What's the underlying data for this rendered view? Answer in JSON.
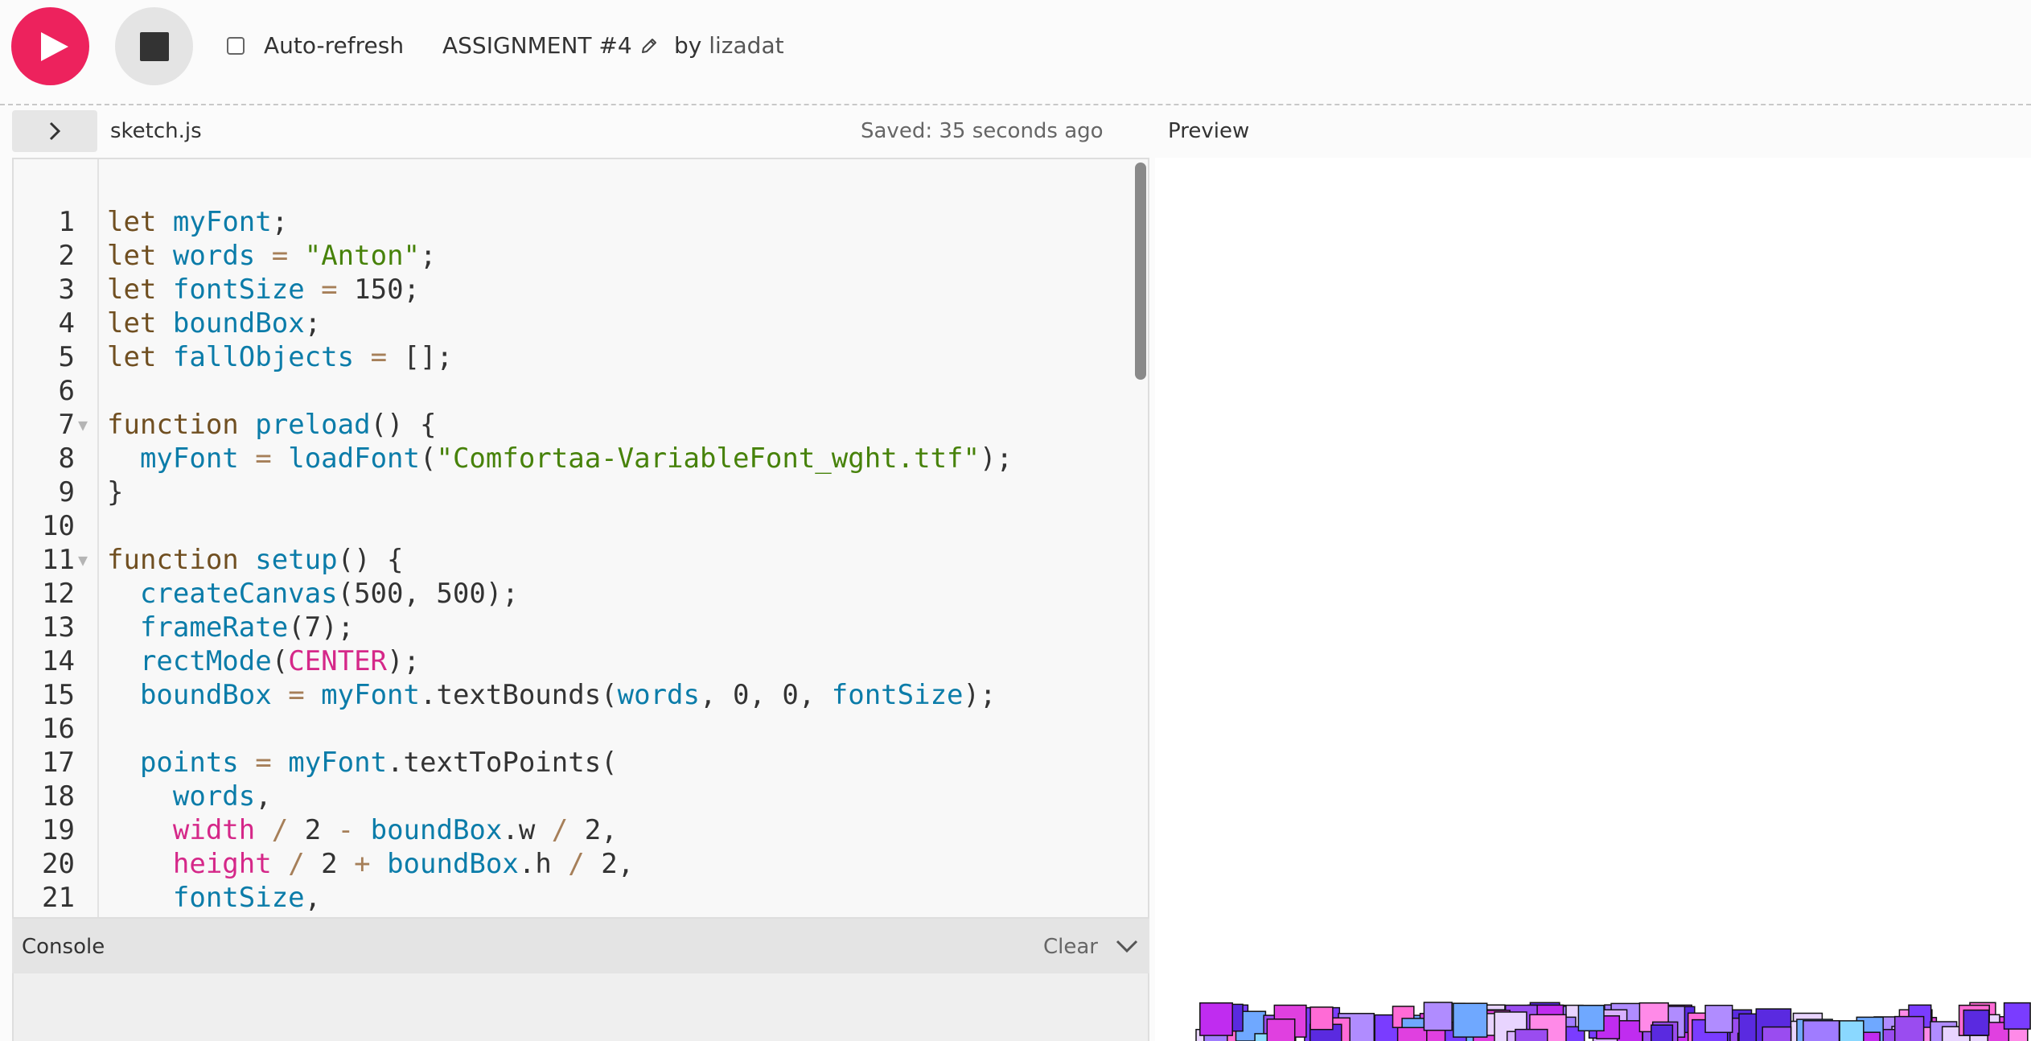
{
  "toolbar": {
    "play_icon": "play-icon",
    "stop_icon": "stop-icon",
    "autorefresh_label": "Auto-refresh",
    "autorefresh_checked": false,
    "project_name": "ASSIGNMENT #4",
    "owner_prefix": "by",
    "owner_name": "lizadat"
  },
  "editor": {
    "file_name": "sketch.js",
    "saved_status": "Saved: 35 seconds ago",
    "lines": [
      {
        "n": "1",
        "fold": false,
        "tokens": [
          [
            "kw",
            "let"
          ],
          [
            "t",
            " "
          ],
          [
            "vr",
            "myFont"
          ],
          [
            "t",
            ";"
          ]
        ]
      },
      {
        "n": "2",
        "fold": false,
        "tokens": [
          [
            "kw",
            "let"
          ],
          [
            "t",
            " "
          ],
          [
            "vr",
            "words"
          ],
          [
            "t",
            " "
          ],
          [
            "op",
            "="
          ],
          [
            "t",
            " "
          ],
          [
            "st",
            "\"Anton\""
          ],
          [
            "t",
            ";"
          ]
        ]
      },
      {
        "n": "3",
        "fold": false,
        "tokens": [
          [
            "kw",
            "let"
          ],
          [
            "t",
            " "
          ],
          [
            "vr",
            "fontSize"
          ],
          [
            "t",
            " "
          ],
          [
            "op",
            "="
          ],
          [
            "t",
            " "
          ],
          [
            "nm",
            "150"
          ],
          [
            "t",
            ";"
          ]
        ]
      },
      {
        "n": "4",
        "fold": false,
        "tokens": [
          [
            "kw",
            "let"
          ],
          [
            "t",
            " "
          ],
          [
            "vr",
            "boundBox"
          ],
          [
            "t",
            ";"
          ]
        ]
      },
      {
        "n": "5",
        "fold": false,
        "tokens": [
          [
            "kw",
            "let"
          ],
          [
            "t",
            " "
          ],
          [
            "vr",
            "fallObjects"
          ],
          [
            "t",
            " "
          ],
          [
            "op",
            "="
          ],
          [
            "t",
            " [];"
          ]
        ]
      },
      {
        "n": "6",
        "fold": false,
        "tokens": []
      },
      {
        "n": "7",
        "fold": true,
        "tokens": [
          [
            "kw",
            "function"
          ],
          [
            "t",
            " "
          ],
          [
            "fn",
            "preload"
          ],
          [
            "t",
            "() {"
          ]
        ]
      },
      {
        "n": "8",
        "fold": false,
        "tokens": [
          [
            "t",
            "  "
          ],
          [
            "vr",
            "myFont"
          ],
          [
            "t",
            " "
          ],
          [
            "op",
            "="
          ],
          [
            "t",
            " "
          ],
          [
            "fn",
            "loadFont"
          ],
          [
            "t",
            "("
          ],
          [
            "st",
            "\"Comfortaa-VariableFont_wght.ttf\""
          ],
          [
            "t",
            ");"
          ]
        ]
      },
      {
        "n": "9",
        "fold": false,
        "tokens": [
          [
            "t",
            "}"
          ]
        ]
      },
      {
        "n": "10",
        "fold": false,
        "tokens": []
      },
      {
        "n": "11",
        "fold": true,
        "tokens": [
          [
            "kw",
            "function"
          ],
          [
            "t",
            " "
          ],
          [
            "fn",
            "setup"
          ],
          [
            "t",
            "() {"
          ]
        ]
      },
      {
        "n": "12",
        "fold": false,
        "tokens": [
          [
            "t",
            "  "
          ],
          [
            "fn",
            "createCanvas"
          ],
          [
            "t",
            "(500, 500);"
          ]
        ]
      },
      {
        "n": "13",
        "fold": false,
        "tokens": [
          [
            "t",
            "  "
          ],
          [
            "fn",
            "frameRate"
          ],
          [
            "t",
            "(7);"
          ]
        ]
      },
      {
        "n": "14",
        "fold": false,
        "tokens": [
          [
            "t",
            "  "
          ],
          [
            "fn",
            "rectMode"
          ],
          [
            "t",
            "("
          ],
          [
            "cn",
            "CENTER"
          ],
          [
            "t",
            ");"
          ]
        ]
      },
      {
        "n": "15",
        "fold": false,
        "tokens": [
          [
            "t",
            "  "
          ],
          [
            "vr",
            "boundBox"
          ],
          [
            "t",
            " "
          ],
          [
            "op",
            "="
          ],
          [
            "t",
            " "
          ],
          [
            "vr",
            "myFont"
          ],
          [
            "t",
            ".textBounds("
          ],
          [
            "vr",
            "words"
          ],
          [
            "t",
            ", 0, 0, "
          ],
          [
            "vr",
            "fontSize"
          ],
          [
            "t",
            ");"
          ]
        ]
      },
      {
        "n": "16",
        "fold": false,
        "tokens": []
      },
      {
        "n": "17",
        "fold": false,
        "tokens": [
          [
            "t",
            "  "
          ],
          [
            "vr",
            "points"
          ],
          [
            "t",
            " "
          ],
          [
            "op",
            "="
          ],
          [
            "t",
            " "
          ],
          [
            "vr",
            "myFont"
          ],
          [
            "t",
            ".textToPoints("
          ]
        ]
      },
      {
        "n": "18",
        "fold": false,
        "tokens": [
          [
            "t",
            "    "
          ],
          [
            "vr",
            "words"
          ],
          [
            "t",
            ","
          ]
        ]
      },
      {
        "n": "19",
        "fold": false,
        "tokens": [
          [
            "t",
            "    "
          ],
          [
            "cn",
            "width"
          ],
          [
            "t",
            " "
          ],
          [
            "op",
            "/"
          ],
          [
            "t",
            " 2 "
          ],
          [
            "op",
            "-"
          ],
          [
            "t",
            " "
          ],
          [
            "vr",
            "boundBox"
          ],
          [
            "t",
            ".w "
          ],
          [
            "op",
            "/"
          ],
          [
            "t",
            " 2,"
          ]
        ]
      },
      {
        "n": "20",
        "fold": false,
        "tokens": [
          [
            "t",
            "    "
          ],
          [
            "cn",
            "height"
          ],
          [
            "t",
            " "
          ],
          [
            "op",
            "/"
          ],
          [
            "t",
            " 2 "
          ],
          [
            "op",
            "+"
          ],
          [
            "t",
            " "
          ],
          [
            "vr",
            "boundBox"
          ],
          [
            "t",
            ".h "
          ],
          [
            "op",
            "/"
          ],
          [
            "t",
            " 2,"
          ]
        ]
      },
      {
        "n": "21",
        "fold": false,
        "tokens": [
          [
            "t",
            "    "
          ],
          [
            "vr",
            "fontSize"
          ],
          [
            "t",
            ","
          ]
        ]
      }
    ]
  },
  "console": {
    "label": "Console",
    "clear_label": "Clear",
    "collapse_icon": "chevron-down-icon"
  },
  "preview": {
    "label": "Preview"
  },
  "colors": {
    "accent": "#ed225d",
    "keyword": "#704f21",
    "variable": "#0b7ca9",
    "string": "#47820a",
    "constant": "#d52889"
  }
}
